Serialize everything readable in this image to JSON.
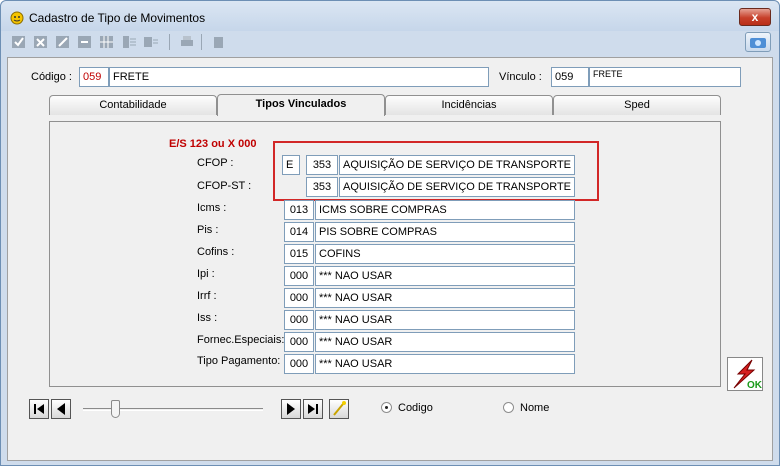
{
  "window": {
    "title": "Cadastro de Tipo de Movimentos",
    "close_label": "x"
  },
  "toolbar": {
    "icons": [
      "check-icon",
      "cancel-icon",
      "edit-icon",
      "delete-icon",
      "grid-icon",
      "list-icon",
      "print-icon",
      "export-icon"
    ]
  },
  "header": {
    "codigo_label": "Código :",
    "codigo_value": "059",
    "codigo_desc": "FRETE",
    "vinculo_label": "Vínculo :",
    "vinculo_value": "059",
    "vinculo_desc": "FRETE"
  },
  "tabs": [
    {
      "label": "Contabilidade"
    },
    {
      "label": "Tipos Vinculados"
    },
    {
      "label": "Incidências"
    },
    {
      "label": "Sped"
    }
  ],
  "panel": {
    "legend": "E/S 123   ou   X 000",
    "rows": [
      {
        "label": "CFOP :",
        "es": "E",
        "code": "353",
        "desc": "AQUISIÇÃO DE SERVIÇO DE TRANSPORTE POR"
      },
      {
        "label": "CFOP-ST :",
        "es": "",
        "code": "353",
        "desc": "AQUISIÇÃO DE SERVIÇO DE TRANSPORTE POR"
      },
      {
        "label": "Icms :",
        "code": "013",
        "desc": "ICMS SOBRE COMPRAS"
      },
      {
        "label": "Pis :",
        "code": "014",
        "desc": "PIS SOBRE COMPRAS"
      },
      {
        "label": "Cofins :",
        "code": "015",
        "desc": "COFINS"
      },
      {
        "label": "Ipi :",
        "code": "000",
        "desc": "*** NAO USAR"
      },
      {
        "label": "Irrf :",
        "code": "000",
        "desc": "*** NAO USAR"
      },
      {
        "label": "Iss :",
        "code": "000",
        "desc": "*** NAO USAR"
      },
      {
        "label": "Fornec.Especiais:",
        "code": "000",
        "desc": "*** NAO USAR"
      },
      {
        "label": "Tipo Pagamento:",
        "code": "000",
        "desc": "*** NAO USAR"
      }
    ]
  },
  "footer": {
    "radio_codigo": "Codigo",
    "radio_nome": "Nome",
    "ok_label": "OK"
  },
  "colors": {
    "accent_red": "#c00000",
    "highlight_red": "#d22727"
  }
}
